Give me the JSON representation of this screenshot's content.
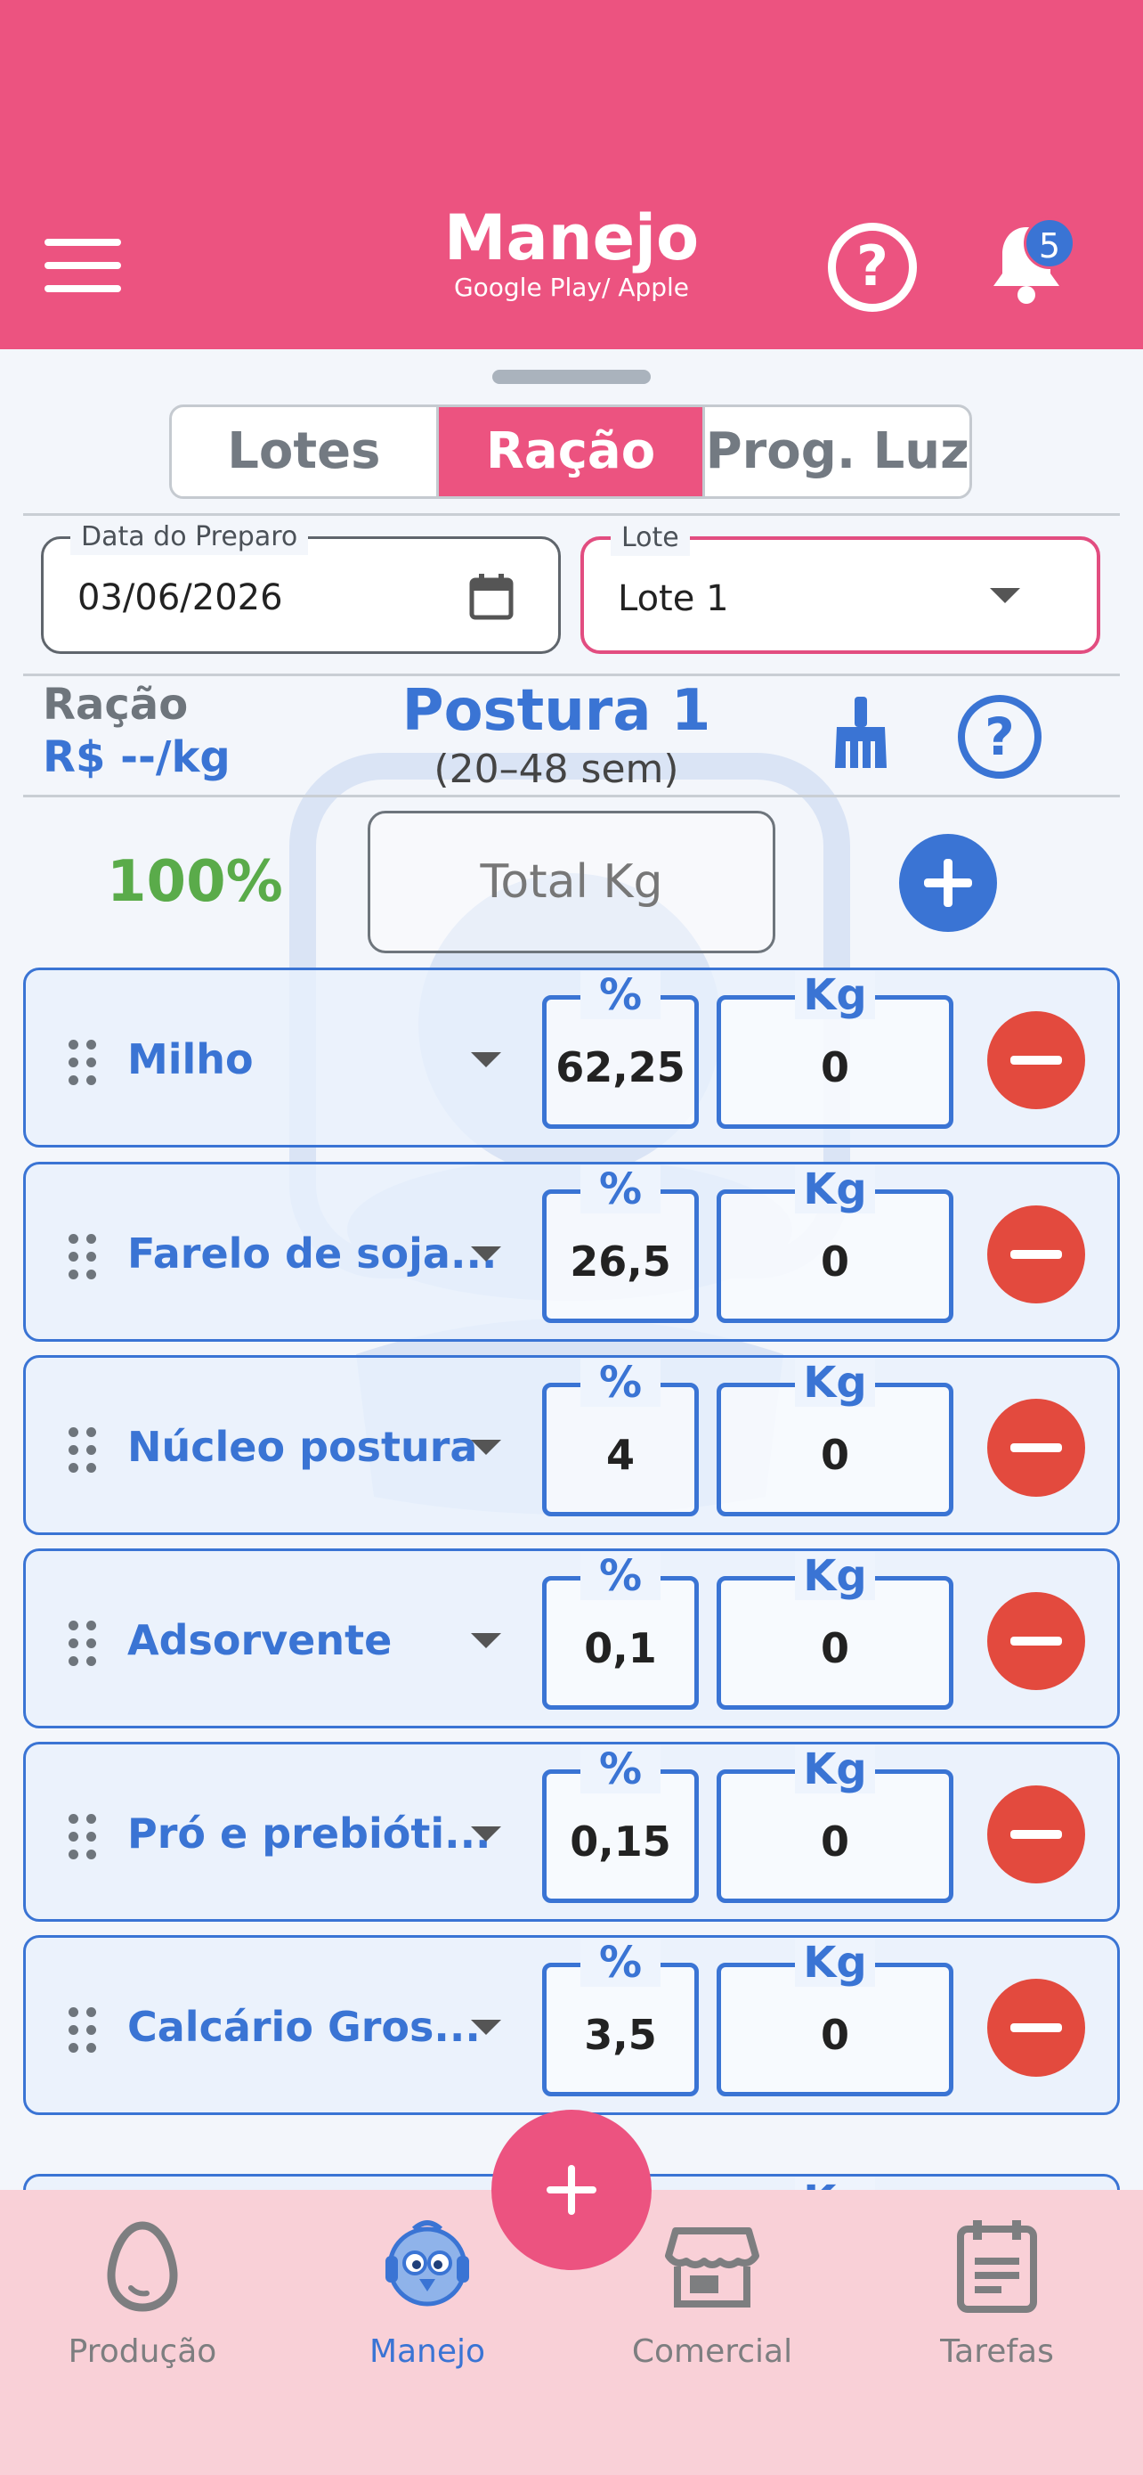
{
  "header": {
    "title": "Manejo",
    "subtitle": "Google Play/ Apple",
    "notifications_count": "5",
    "help_label": "?",
    "colors": {
      "header_bg": "#ec5380",
      "accent_blue": "#3a74d4",
      "remove_red": "#e34a3e",
      "total_green": "#5aab4a"
    }
  },
  "tabs": [
    {
      "label": "Lotes",
      "active": false
    },
    {
      "label": "Ração",
      "active": true
    },
    {
      "label": "Prog. Luz",
      "active": false
    }
  ],
  "form": {
    "date_label": "Data do Preparo",
    "date_value": "03/06/2026",
    "lote_label": "Lote",
    "lote_value": "Lote 1"
  },
  "ration": {
    "label": "Ração",
    "price": "R$ --/kg",
    "formula_name": "Postura 1",
    "formula_range": "(20–48 sem)",
    "help_label": "?",
    "total_percent": "100%",
    "total_kg_placeholder": "Total Kg"
  },
  "ingredient_headers": {
    "percent": "%",
    "kg": "Kg"
  },
  "ingredients": [
    {
      "name": "Milho",
      "percent": "62,25",
      "kg": "0"
    },
    {
      "name": "Farelo de soja...",
      "percent": "26,5",
      "kg": "0"
    },
    {
      "name": "Núcleo postura",
      "percent": "4",
      "kg": "0"
    },
    {
      "name": "Adsorvente",
      "percent": "0,1",
      "kg": "0"
    },
    {
      "name": "Pró e prebióti...",
      "percent": "0,15",
      "kg": "0"
    },
    {
      "name": "Calcário Gros...",
      "percent": "3,5",
      "kg": "0"
    }
  ],
  "partial_row": {
    "kg_label": "Kg"
  },
  "nav": [
    {
      "label": "Produção",
      "icon": "egg-icon",
      "active": false
    },
    {
      "label": "Manejo",
      "icon": "chick-mascot-icon",
      "active": true
    },
    {
      "label": "Comercial",
      "icon": "store-icon",
      "active": false
    },
    {
      "label": "Tarefas",
      "icon": "clipboard-icon",
      "active": false
    }
  ]
}
